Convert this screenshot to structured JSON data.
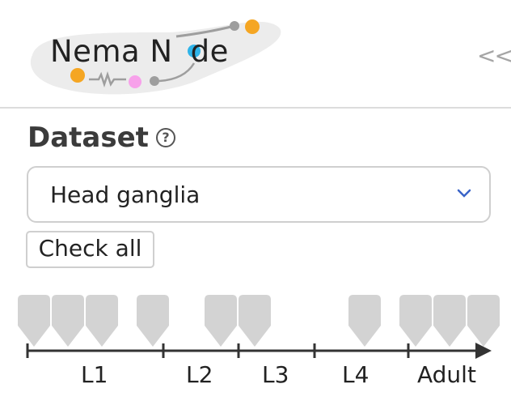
{
  "logo": {
    "text_before": "Nema N",
    "text_after": "de",
    "accent_colors": [
      "#f5a623",
      "#f7a1ea",
      "#9e9e9e"
    ]
  },
  "header": {
    "collapse_label": "<<"
  },
  "dataset": {
    "title": "Dataset",
    "help_icon": "question-circle-icon",
    "selected": "Head ganglia"
  },
  "check_all_label": "Check all",
  "timeline": {
    "stages": [
      "L1",
      "L2",
      "L3",
      "L4",
      "Adult"
    ],
    "markers": 10,
    "marker_color": "#d3d3d3"
  }
}
